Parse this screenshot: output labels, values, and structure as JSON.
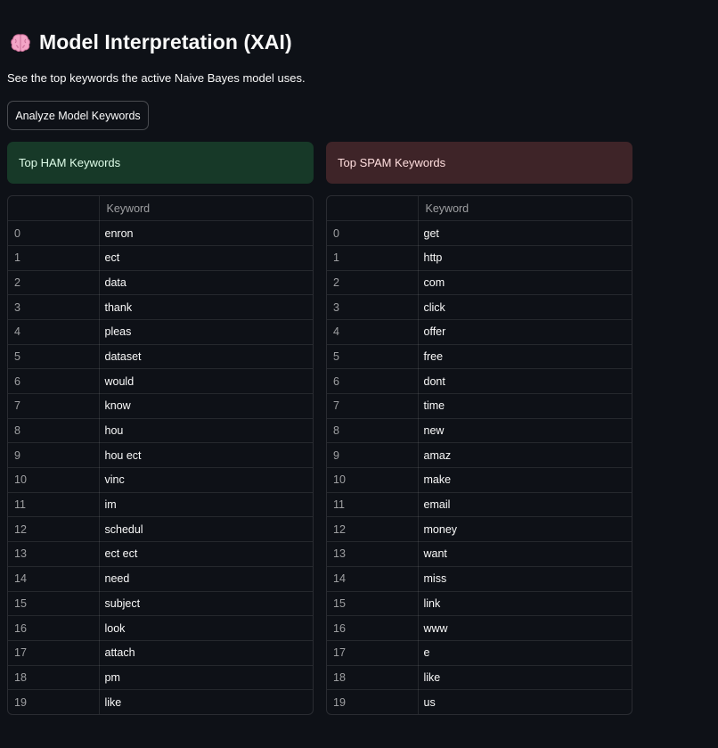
{
  "header": {
    "title": "Model Interpretation (XAI)",
    "subtitle": "See the top keywords the active Naive Bayes model uses.",
    "icon": "brain-icon"
  },
  "actions": {
    "analyze_label": "Analyze Model Keywords"
  },
  "colors": {
    "background": "#0e1117",
    "ham_banner": "#173928",
    "spam_banner": "#3e2428"
  },
  "ham": {
    "banner": "Top HAM Keywords",
    "column_header": "Keyword",
    "rows": [
      {
        "index": "0",
        "keyword": "enron"
      },
      {
        "index": "1",
        "keyword": "ect"
      },
      {
        "index": "2",
        "keyword": "data"
      },
      {
        "index": "3",
        "keyword": "thank"
      },
      {
        "index": "4",
        "keyword": "pleas"
      },
      {
        "index": "5",
        "keyword": "dataset"
      },
      {
        "index": "6",
        "keyword": "would"
      },
      {
        "index": "7",
        "keyword": "know"
      },
      {
        "index": "8",
        "keyword": "hou"
      },
      {
        "index": "9",
        "keyword": "hou ect"
      },
      {
        "index": "10",
        "keyword": "vinc"
      },
      {
        "index": "11",
        "keyword": "im"
      },
      {
        "index": "12",
        "keyword": "schedul"
      },
      {
        "index": "13",
        "keyword": "ect ect"
      },
      {
        "index": "14",
        "keyword": "need"
      },
      {
        "index": "15",
        "keyword": "subject"
      },
      {
        "index": "16",
        "keyword": "look"
      },
      {
        "index": "17",
        "keyword": "attach"
      },
      {
        "index": "18",
        "keyword": "pm"
      },
      {
        "index": "19",
        "keyword": "like"
      }
    ]
  },
  "spam": {
    "banner": "Top SPAM Keywords",
    "column_header": "Keyword",
    "rows": [
      {
        "index": "0",
        "keyword": "get"
      },
      {
        "index": "1",
        "keyword": "http"
      },
      {
        "index": "2",
        "keyword": "com"
      },
      {
        "index": "3",
        "keyword": "click"
      },
      {
        "index": "4",
        "keyword": "offer"
      },
      {
        "index": "5",
        "keyword": "free"
      },
      {
        "index": "6",
        "keyword": "dont"
      },
      {
        "index": "7",
        "keyword": "time"
      },
      {
        "index": "8",
        "keyword": "new"
      },
      {
        "index": "9",
        "keyword": "amaz"
      },
      {
        "index": "10",
        "keyword": "make"
      },
      {
        "index": "11",
        "keyword": "email"
      },
      {
        "index": "12",
        "keyword": "money"
      },
      {
        "index": "13",
        "keyword": "want"
      },
      {
        "index": "14",
        "keyword": "miss"
      },
      {
        "index": "15",
        "keyword": "link"
      },
      {
        "index": "16",
        "keyword": "www"
      },
      {
        "index": "17",
        "keyword": "e"
      },
      {
        "index": "18",
        "keyword": "like"
      },
      {
        "index": "19",
        "keyword": "us"
      }
    ]
  }
}
